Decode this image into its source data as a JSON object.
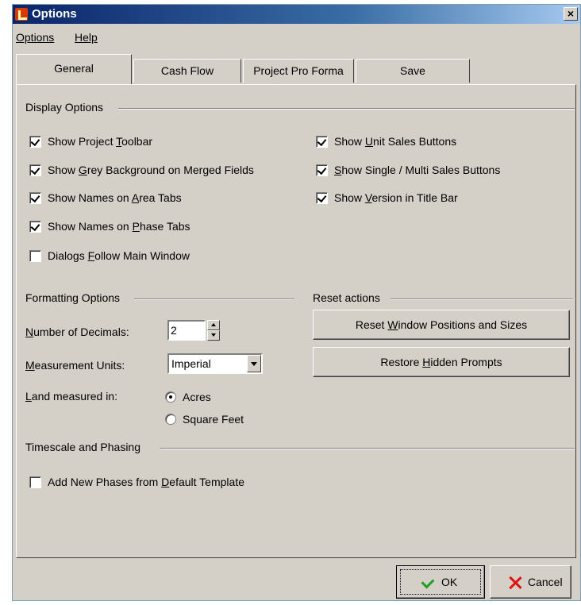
{
  "window": {
    "title": "Options",
    "close_label": "×"
  },
  "menu": [
    "Options",
    "Help"
  ],
  "tabs": [
    "General",
    "Cash Flow",
    "Project Pro Forma",
    "Save"
  ],
  "display_options": {
    "heading": "Display Options",
    "left": [
      {
        "pre": "Show Project ",
        "key": "T",
        "post": "oolbar",
        "checked": true
      },
      {
        "pre": "Show ",
        "key": "G",
        "post": "rey Background on Merged Fields",
        "checked": true
      },
      {
        "pre": "Show Names on ",
        "key": "A",
        "post": "rea Tabs",
        "checked": true
      },
      {
        "pre": "Show Names on ",
        "key": "P",
        "post": "hase Tabs",
        "checked": true
      },
      {
        "pre": "Dialogs ",
        "key": "F",
        "post": "ollow Main Window",
        "checked": false
      }
    ],
    "right": [
      {
        "pre": "Show ",
        "key": "U",
        "post": "nit Sales Buttons",
        "checked": true
      },
      {
        "pre": "",
        "key": "S",
        "post": "how Single / Multi Sales Buttons",
        "checked": true
      },
      {
        "pre": "Show ",
        "key": "V",
        "post": "ersion in Title Bar",
        "checked": true
      }
    ]
  },
  "formatting": {
    "heading": "Formatting Options",
    "decimals_label": {
      "key": "N",
      "post": "umber of Decimals:"
    },
    "decimals_value": "2",
    "units_label": {
      "key": "M",
      "post": "easurement Units:"
    },
    "units_value": "Imperial",
    "land_label": {
      "key": "L",
      "post": "and measured in:"
    },
    "land_options": [
      {
        "label": "Acres",
        "selected": true
      },
      {
        "label": "Square Feet",
        "selected": false
      }
    ]
  },
  "reset": {
    "heading": "Reset actions",
    "reset_windows": {
      "pre": "Reset ",
      "key": "W",
      "post": "indow Positions and Sizes"
    },
    "restore_prompts": {
      "pre": "Restore ",
      "key": "H",
      "post": "idden Prompts"
    }
  },
  "timescale": {
    "heading": "Timescale and Phasing",
    "add_phases": {
      "pre": "Add New Phases from ",
      "key": "D",
      "post": "efault Template",
      "checked": false
    }
  },
  "footer": {
    "ok": "OK",
    "cancel": "Cancel"
  },
  "colors": {
    "face": "#d4d0c8",
    "title_start": "#0a246a",
    "title_end": "#a6caf0"
  },
  "icons": {
    "title": "app-icon",
    "ok": "check-icon",
    "cancel": "x-icon"
  }
}
